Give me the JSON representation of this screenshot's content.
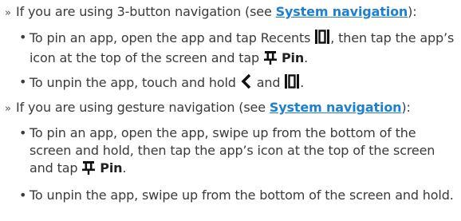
{
  "sections": [
    {
      "intro_prefix": "If you are using 3-button navigation (see ",
      "link": "System navigation",
      "intro_suffix": "):",
      "bullets": {
        "pin": {
          "part1": "To pin an app, open the app and tap Recents ",
          "part2": ", then tap the app’s icon at the top of the screen and tap ",
          "pin_label": "Pin",
          "end": "."
        },
        "unpin": {
          "part1": "To unpin the app, touch and hold ",
          "part2": " and ",
          "end": "."
        }
      }
    },
    {
      "intro_prefix": "If you are using gesture navigation (see ",
      "link": "System navigation",
      "intro_suffix": "):",
      "bullets": {
        "pin": {
          "part1": "To pin an app, open the app, swipe up from the bottom of the screen and hold, then tap the app’s icon at the top of the screen and tap ",
          "pin_label": "Pin",
          "end": "."
        },
        "unpin": {
          "text": "To unpin the app, swipe up from the bottom of the screen and hold."
        }
      }
    }
  ],
  "marker_chevron": "»",
  "marker_bullet": "•",
  "icons": [
    "recents-icon",
    "back-icon",
    "pin-icon"
  ],
  "colors": {
    "text": "#3a3a3a",
    "link": "#1e7fd1"
  }
}
